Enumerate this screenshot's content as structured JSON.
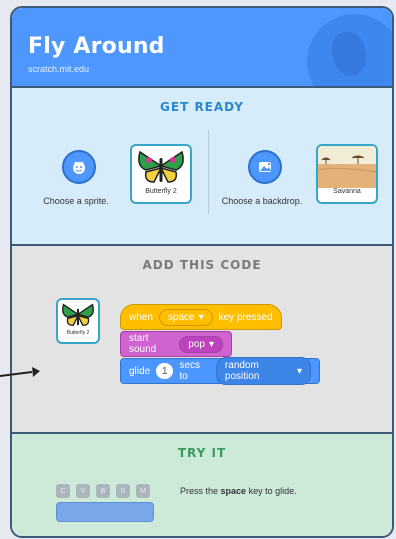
{
  "header": {
    "title": "Fly Around",
    "subtitle": "scratch.mit.edu"
  },
  "get_ready": {
    "title": "GET READY",
    "choose_sprite": "Choose a sprite.",
    "sprite_name": "Butterfly 2",
    "choose_backdrop": "Choose a backdrop.",
    "backdrop_name": "Savanna"
  },
  "add_code": {
    "title": "ADD THIS CODE",
    "sprite_label": "Butterfly 2",
    "blocks": {
      "when": "when",
      "key": "space",
      "key_pressed": "key pressed",
      "start_sound": "start sound",
      "sound": "pop",
      "glide": "glide",
      "secs": "1",
      "secs_to": "secs to",
      "target": "random position"
    }
  },
  "try_it": {
    "title": "TRY IT",
    "keys": [
      "C",
      "V",
      "B",
      "N",
      "M"
    ],
    "text_pre": "Press the ",
    "text_key": "space",
    "text_post": " key to glide."
  }
}
